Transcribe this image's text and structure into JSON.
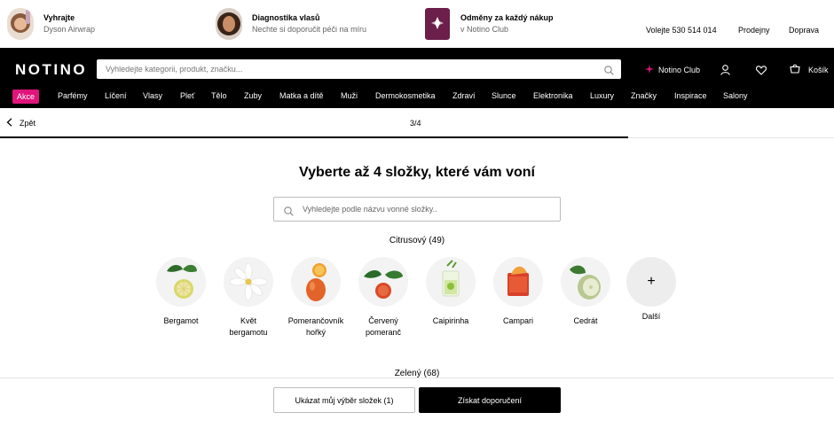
{
  "promo": [
    {
      "title": "Vyhrajte",
      "subtitle": "Dyson Airwrap"
    },
    {
      "title": "Diagnostika vlasů",
      "subtitle": "Nechte si doporučit péči na míru"
    },
    {
      "title": "Odměny za každý nákup",
      "subtitle": "v Notino Club"
    }
  ],
  "top_links": {
    "phone": "Volejte 530 514 014",
    "stores": "Prodejny",
    "shipping": "Doprava"
  },
  "header": {
    "logo": "NOTINO",
    "search_placeholder": "Vyhledejte kategorii, produkt, značku...",
    "club": "Notino Club",
    "cart": "Košík"
  },
  "nav": [
    "Akce",
    "Parfémy",
    "Líčení",
    "Vlasy",
    "Pleť",
    "Tělo",
    "Zuby",
    "Matka a dítě",
    "Muži",
    "Dermokosmetika",
    "Zdraví",
    "Slunce",
    "Elektronika",
    "Luxury",
    "Značky",
    "Inspirace",
    "Salony"
  ],
  "progress": {
    "back": "Zpět",
    "step": "3/4",
    "value": 0.75
  },
  "main": {
    "title": "Vyberte až 4 složky, které vám voní",
    "search_placeholder": "Vyhledejte podle názvu vonné složky..",
    "category": "Citrusový (49)",
    "next_category": "Zelený (68)",
    "ingredients": [
      {
        "line1": "Bergamot",
        "line2": "",
        "icon": "bergamot-image"
      },
      {
        "line1": "Květ",
        "line2": "bergamotu",
        "icon": "bergamot-flower-image"
      },
      {
        "line1": "Pomerančovník",
        "line2": "hořký",
        "icon": "bitter-orange-image"
      },
      {
        "line1": "Červený",
        "line2": "pomeranč",
        "icon": "blood-orange-image"
      },
      {
        "line1": "Caipirinha",
        "line2": "",
        "icon": "caipirinha-image"
      },
      {
        "line1": "Campari",
        "line2": "",
        "icon": "campari-image"
      },
      {
        "line1": "Cedrát",
        "line2": "",
        "icon": "citron-image"
      }
    ],
    "more": {
      "symbol": "+",
      "label": "Další"
    }
  },
  "bottom": {
    "show_selection": "Ukázat můj výběr složek (1)",
    "get_recommendation": "Získat doporučení"
  },
  "colors": {
    "accent": "#e0157b",
    "header_bg": "#000000"
  }
}
